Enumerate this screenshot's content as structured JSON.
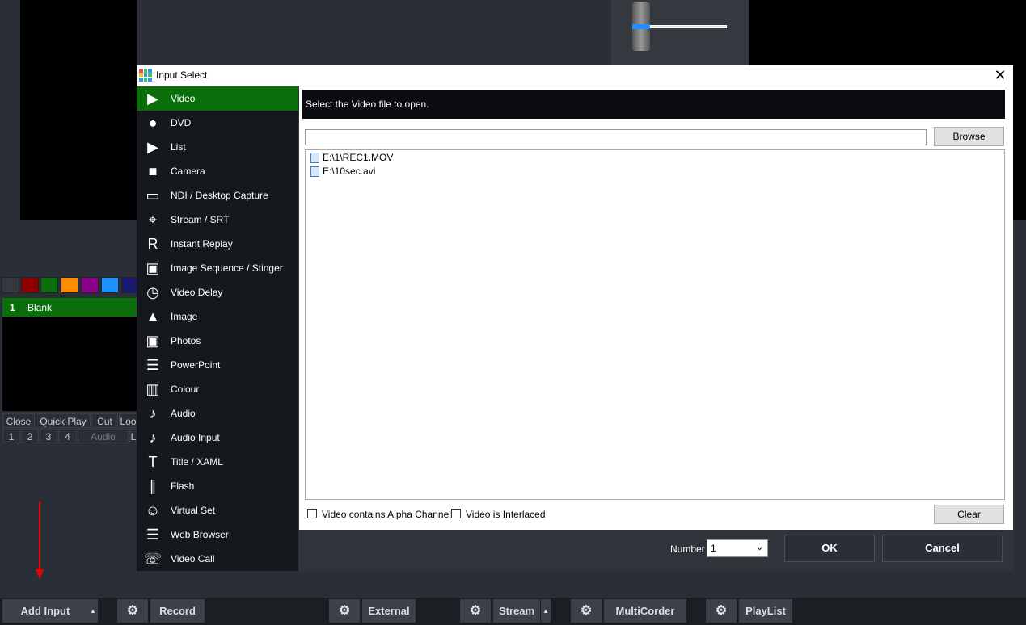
{
  "colors": {
    "accent": "#0a6e0a",
    "swatches": [
      "#34383f",
      "#8b0000",
      "#0a6e0a",
      "#ff8c00",
      "#8b008b",
      "#1e90ff",
      "#191970"
    ]
  },
  "input": {
    "number": "1",
    "name": "Blank"
  },
  "input_buttons": {
    "close": "Close",
    "quick_play": "Quick Play",
    "cut": "Cut",
    "loop": "Loo"
  },
  "input_numbers": {
    "n1": "1",
    "n2": "2",
    "n3": "3",
    "n4": "4",
    "audio": "Audio",
    "extra": "L"
  },
  "bottom": {
    "add_input": "Add Input",
    "record": "Record",
    "external": "External",
    "stream": "Stream",
    "multicorder": "MultiCorder",
    "playlist": "PlayList",
    "gear": "⚙",
    "caret": "▲"
  },
  "dialog": {
    "title": "Input Select",
    "close": "✕",
    "hint": "Select the Video file to open.",
    "browse": "Browse",
    "path_value": "",
    "files": [
      "E:\\1\\REC1.MOV",
      "E:\\10sec.avi"
    ],
    "alpha_label": "Video contains Alpha Channel",
    "interlaced_label": "Video is Interlaced",
    "clear": "Clear",
    "number_label": "Number",
    "number_value": "1",
    "ok": "OK",
    "cancel": "Cancel",
    "sidebar": [
      {
        "label": "Video",
        "icon": "play-icon",
        "glyph": "▶"
      },
      {
        "label": "DVD",
        "icon": "disc-icon",
        "glyph": "●"
      },
      {
        "label": "List",
        "icon": "list-icon",
        "glyph": "▶"
      },
      {
        "label": "Camera",
        "icon": "camera-icon",
        "glyph": "■"
      },
      {
        "label": "NDI / Desktop Capture",
        "icon": "monitor-icon",
        "glyph": "▭"
      },
      {
        "label": "Stream / SRT",
        "icon": "antenna-icon",
        "glyph": "⌖"
      },
      {
        "label": "Instant Replay",
        "icon": "replay-icon",
        "glyph": "R"
      },
      {
        "label": "Image Sequence / Stinger",
        "icon": "image-sequence-icon",
        "glyph": "▣"
      },
      {
        "label": "Video Delay",
        "icon": "clock-icon",
        "glyph": "◷"
      },
      {
        "label": "Image",
        "icon": "image-icon",
        "glyph": "▲"
      },
      {
        "label": "Photos",
        "icon": "photos-icon",
        "glyph": "▣"
      },
      {
        "label": "PowerPoint",
        "icon": "presentation-icon",
        "glyph": "☰"
      },
      {
        "label": "Colour",
        "icon": "colour-icon",
        "glyph": "▥"
      },
      {
        "label": "Audio",
        "icon": "microphone-icon",
        "glyph": "♪"
      },
      {
        "label": "Audio Input",
        "icon": "microphone-input-icon",
        "glyph": "♪"
      },
      {
        "label": "Title / XAML",
        "icon": "title-icon",
        "glyph": "T"
      },
      {
        "label": "Flash",
        "icon": "flash-icon",
        "glyph": "∥"
      },
      {
        "label": "Virtual Set",
        "icon": "virtual-set-icon",
        "glyph": "☺"
      },
      {
        "label": "Web Browser",
        "icon": "browser-icon",
        "glyph": "☰"
      },
      {
        "label": "Video Call",
        "icon": "video-call-icon",
        "glyph": "☏"
      }
    ]
  }
}
